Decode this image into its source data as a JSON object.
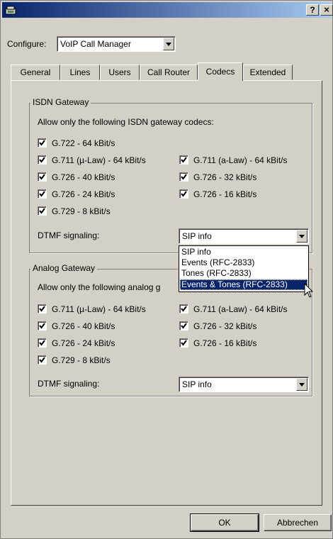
{
  "title_bar": {
    "help_label": "?",
    "close_label": "×"
  },
  "configure": {
    "label": "Configure:",
    "value": "VoIP Call Manager"
  },
  "tabs": [
    {
      "label": "General"
    },
    {
      "label": "Lines"
    },
    {
      "label": "Users"
    },
    {
      "label": "Call Router"
    },
    {
      "label": "Codecs",
      "active": true
    },
    {
      "label": "Extended"
    }
  ],
  "isdn": {
    "title": "ISDN Gateway",
    "prompt": "Allow only the following ISDN gateway codecs:",
    "codecs": [
      {
        "label": "G.722 - 64 kBit/s",
        "checked": true
      },
      {
        "label": "G.711 (µ-Law) - 64 kBit/s",
        "checked": true
      },
      {
        "label": "G.711 (a-Law) - 64 kBit/s",
        "checked": true
      },
      {
        "label": "G.726 - 40 kBit/s",
        "checked": true
      },
      {
        "label": "G.726 - 32 kBit/s",
        "checked": true
      },
      {
        "label": "G.726 - 24 kBit/s",
        "checked": true
      },
      {
        "label": "G.726 - 16 kBit/s",
        "checked": true
      },
      {
        "label": "G.729 -  8 kBit/s",
        "checked": true
      }
    ],
    "dtmf_label": "DTMF signaling:",
    "dtmf_value": "SIP info"
  },
  "dtmf_options": [
    {
      "label": "SIP info"
    },
    {
      "label": "Events (RFC-2833)"
    },
    {
      "label": "Tones (RFC-2833)"
    },
    {
      "label": "Events & Tones (RFC-2833)",
      "highlighted": true
    }
  ],
  "analog": {
    "title": "Analog Gateway",
    "prompt": "Allow only the following analog g",
    "codecs": [
      {
        "label": "G.711 (µ-Law) - 64 kBit/s",
        "checked": true
      },
      {
        "label": "G.711 (a-Law) - 64 kBit/s",
        "checked": true
      },
      {
        "label": "G.726 - 40 kBit/s",
        "checked": true
      },
      {
        "label": "G.726 - 32 kBit/s",
        "checked": true
      },
      {
        "label": "G.726 - 24 kBit/s",
        "checked": true
      },
      {
        "label": "G.726 - 16 kBit/s",
        "checked": true
      },
      {
        "label": "G.729 -  8 kBit/s",
        "checked": true
      }
    ],
    "dtmf_label": "DTMF signaling:",
    "dtmf_value": "SIP info"
  },
  "buttons": {
    "ok": "OK",
    "cancel": "Abbrechen"
  }
}
